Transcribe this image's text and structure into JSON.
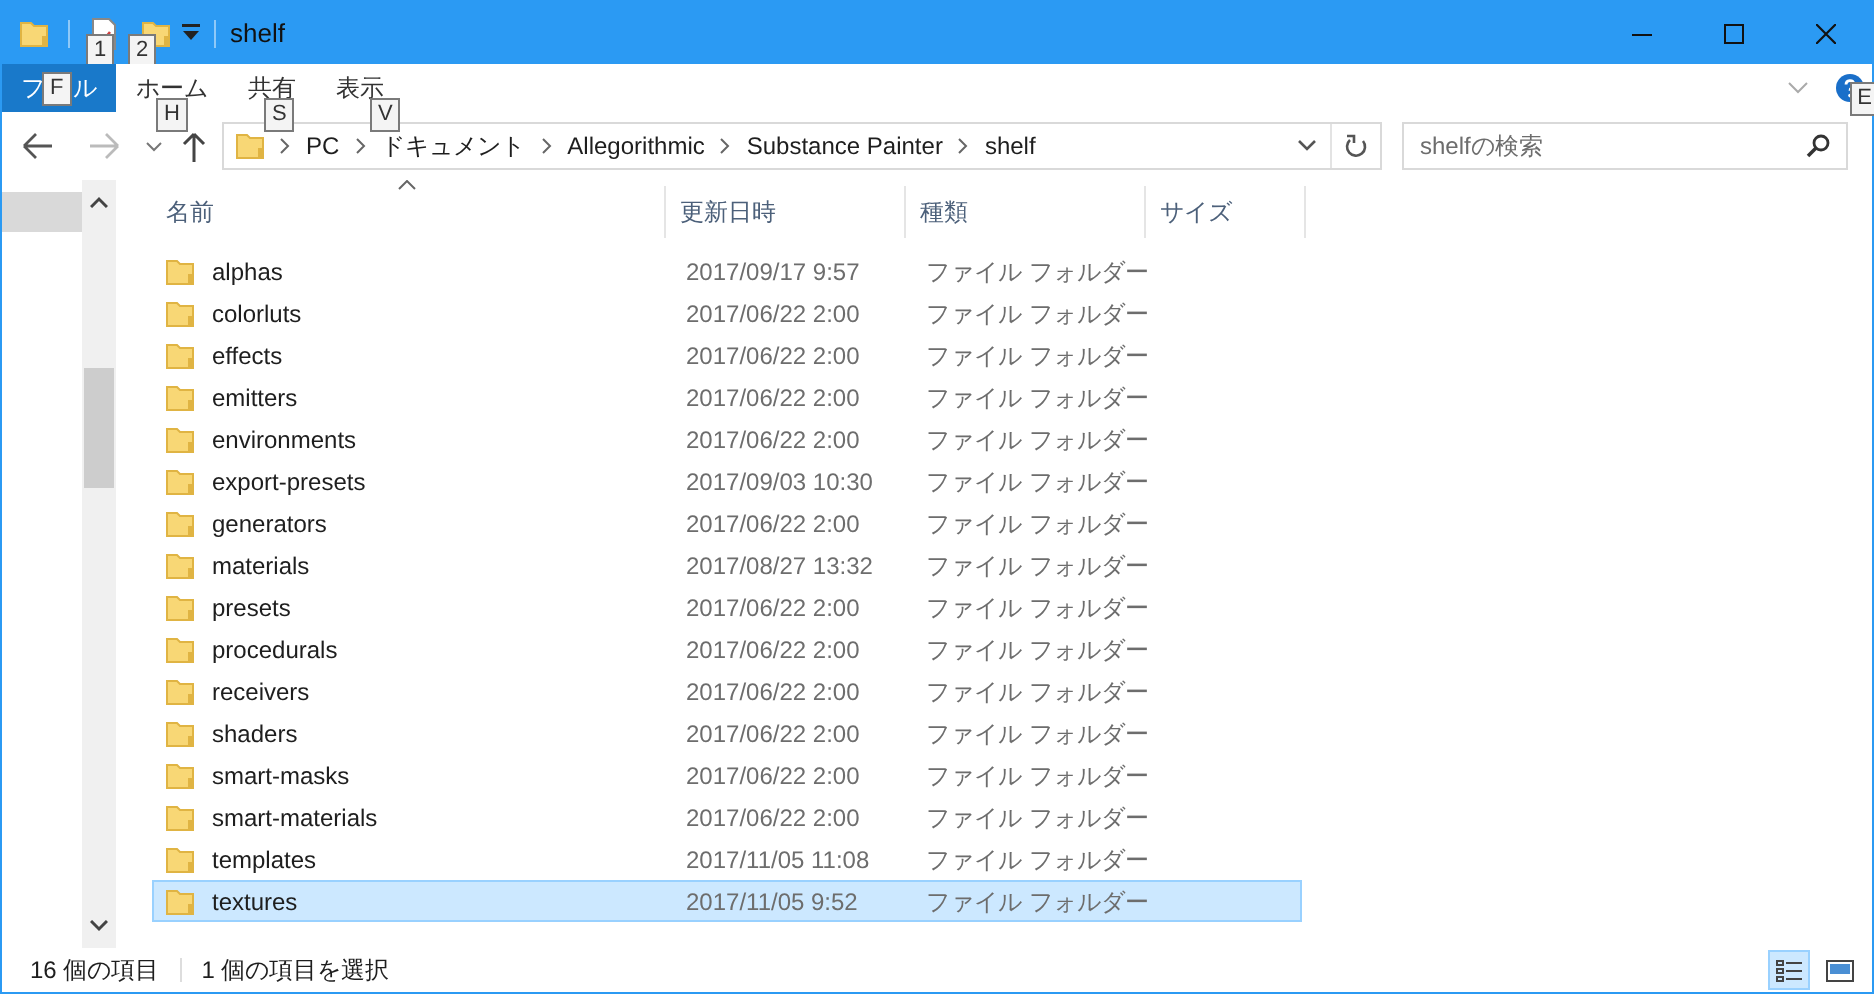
{
  "window": {
    "title": "shelf",
    "quick_access_keytips": [
      "1",
      "2"
    ]
  },
  "ribbon": {
    "tabs": [
      {
        "kind": "file",
        "parts": [
          "フ",
          "ル"
        ],
        "keytip": "F",
        "selected": true
      },
      {
        "kind": "tab",
        "label": "ホーム",
        "keytip": "H",
        "selected": false
      },
      {
        "kind": "tab",
        "label": "共有",
        "keytip": "S",
        "selected": false
      },
      {
        "kind": "tab",
        "label": "表示",
        "keytip": "V",
        "selected": false
      }
    ],
    "help_keytip": "E"
  },
  "address_bar": {
    "crumbs": [
      "PC",
      "ドキュメント",
      "Allegorithmic",
      "Substance Painter",
      "shelf"
    ]
  },
  "search": {
    "placeholder": "shelfの検索"
  },
  "table": {
    "columns": [
      "名前",
      "更新日時",
      "種類",
      "サイズ"
    ],
    "rows": [
      {
        "name": "alphas",
        "date": "2017/09/17 9:57",
        "type": "ファイル フォルダー",
        "selected": false
      },
      {
        "name": "colorluts",
        "date": "2017/06/22 2:00",
        "type": "ファイル フォルダー",
        "selected": false
      },
      {
        "name": "effects",
        "date": "2017/06/22 2:00",
        "type": "ファイル フォルダー",
        "selected": false
      },
      {
        "name": "emitters",
        "date": "2017/06/22 2:00",
        "type": "ファイル フォルダー",
        "selected": false
      },
      {
        "name": "environments",
        "date": "2017/06/22 2:00",
        "type": "ファイル フォルダー",
        "selected": false
      },
      {
        "name": "export-presets",
        "date": "2017/09/03 10:30",
        "type": "ファイル フォルダー",
        "selected": false
      },
      {
        "name": "generators",
        "date": "2017/06/22 2:00",
        "type": "ファイル フォルダー",
        "selected": false
      },
      {
        "name": "materials",
        "date": "2017/08/27 13:32",
        "type": "ファイル フォルダー",
        "selected": false
      },
      {
        "name": "presets",
        "date": "2017/06/22 2:00",
        "type": "ファイル フォルダー",
        "selected": false
      },
      {
        "name": "procedurals",
        "date": "2017/06/22 2:00",
        "type": "ファイル フォルダー",
        "selected": false
      },
      {
        "name": "receivers",
        "date": "2017/06/22 2:00",
        "type": "ファイル フォルダー",
        "selected": false
      },
      {
        "name": "shaders",
        "date": "2017/06/22 2:00",
        "type": "ファイル フォルダー",
        "selected": false
      },
      {
        "name": "smart-masks",
        "date": "2017/06/22 2:00",
        "type": "ファイル フォルダー",
        "selected": false
      },
      {
        "name": "smart-materials",
        "date": "2017/06/22 2:00",
        "type": "ファイル フォルダー",
        "selected": false
      },
      {
        "name": "templates",
        "date": "2017/11/05 11:08",
        "type": "ファイル フォルダー",
        "selected": false
      },
      {
        "name": "textures",
        "date": "2017/11/05 9:52",
        "type": "ファイル フォルダー",
        "selected": true
      }
    ]
  },
  "status_bar": {
    "item_count": "16 個の項目",
    "selection": "1 個の項目を選択"
  }
}
